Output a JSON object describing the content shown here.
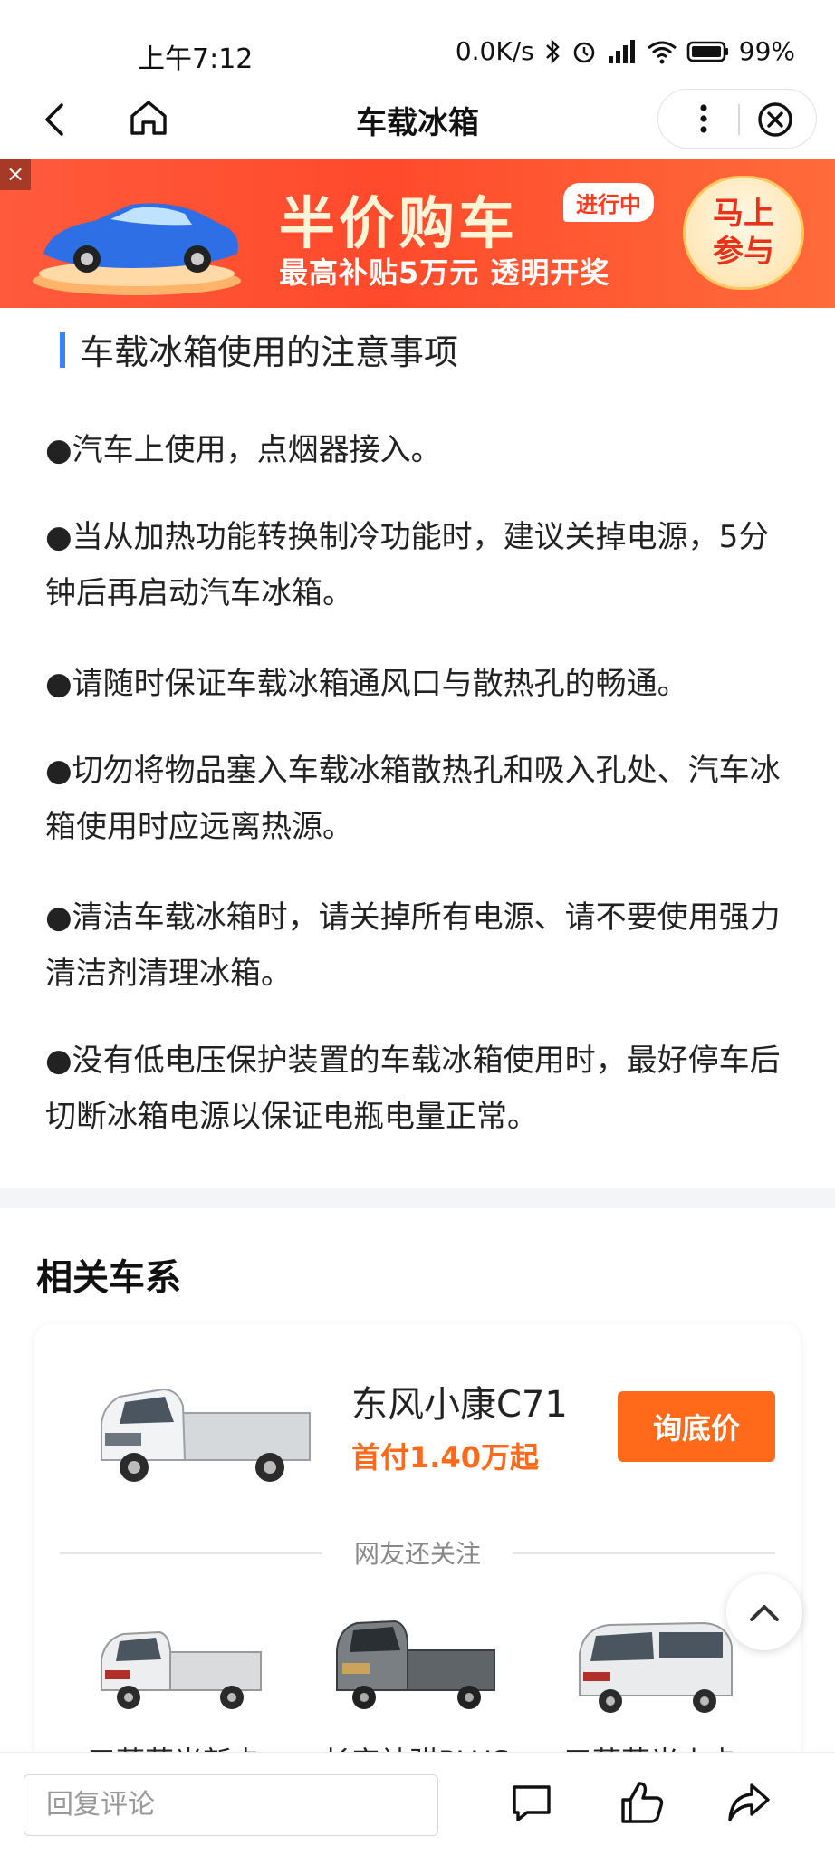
{
  "status_bar": {
    "time": "上午7:12",
    "network_speed": "0.0K/s",
    "battery": "99%"
  },
  "nav": {
    "title": "车载冰箱"
  },
  "banner": {
    "close_label": "×",
    "headline": "半价购车",
    "status_tag": "进行中",
    "subline": "最高补贴5万元 透明开奖",
    "cta": "马上参与"
  },
  "article": {
    "heading": "车载冰箱使用的注意事项",
    "paragraphs": [
      "●汽车上使用，点烟器接入。",
      "●当从加热功能转换制冷功能时，建议关掉电源，5分钟后再启动汽车冰箱。",
      "●请随时保证车载冰箱通风口与散热孔的畅通。",
      "●切勿将物品塞入车载冰箱散热孔和吸入孔处、汽车冰箱使用时应远离热源。",
      "●清洁车载冰箱时，请关掉所有电源、请不要使用强力清洁剂清理冰箱。",
      "●没有低电压保护装置的车载冰箱使用时，最好停车后切断冰箱电源以保证电瓶电量正常。"
    ]
  },
  "related": {
    "title": "相关车系",
    "main_car": {
      "name": "东风小康C71",
      "price": "首付1.40万起",
      "button": "询底价"
    },
    "also_watch": "网友还关注",
    "thumbnails": [
      {
        "label": "五菱荣光新卡"
      },
      {
        "label": "长安神骐PLUS"
      },
      {
        "label": "五菱荣光小卡"
      }
    ]
  },
  "bottom_bar": {
    "comment_placeholder": "回复评论",
    "icons": [
      "comment-icon",
      "like-icon",
      "share-icon"
    ]
  },
  "colors": {
    "accent_orange": "#ff6a1a",
    "banner_red": "#ff4a2c",
    "heading_bar_blue": "#3b82f6"
  }
}
